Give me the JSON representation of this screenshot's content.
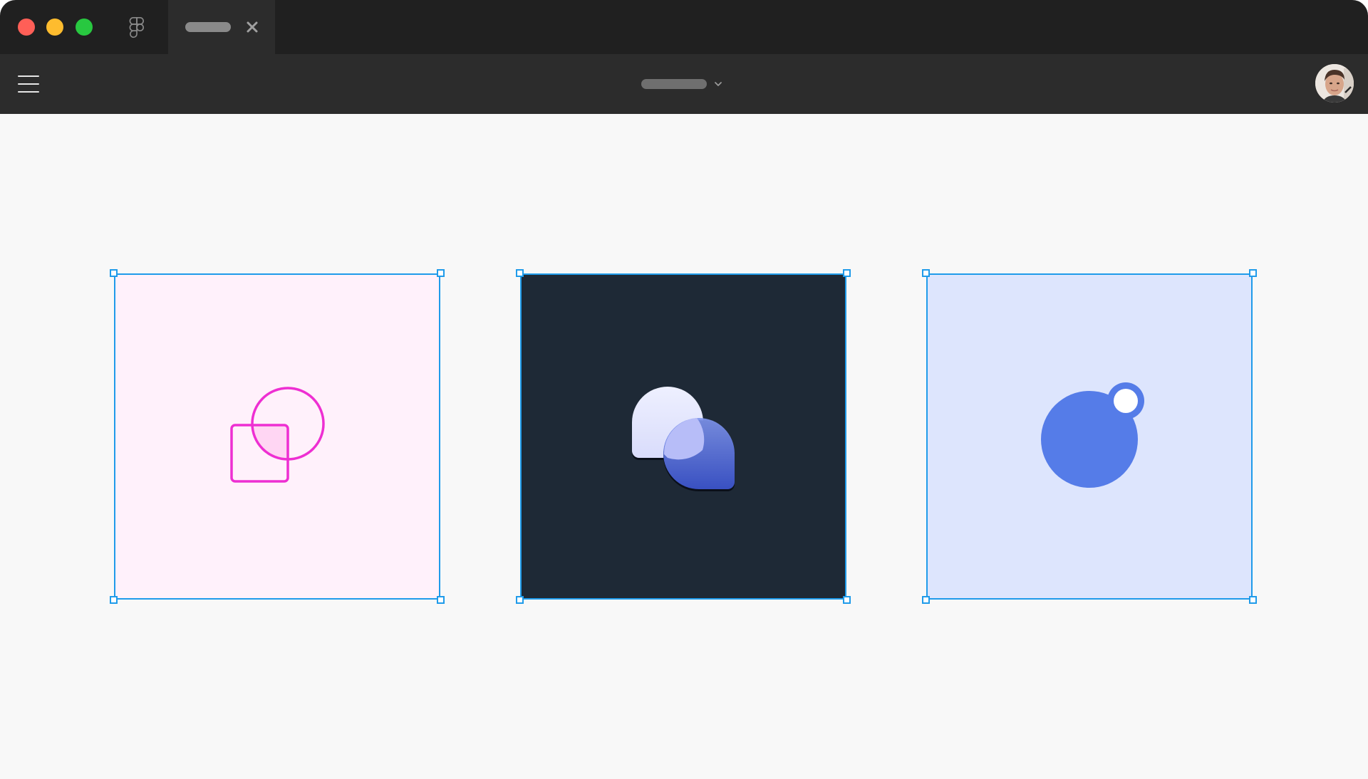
{
  "window": {
    "traffic_lights": [
      "close",
      "minimize",
      "maximize"
    ],
    "app_icon": "figma-logo-icon",
    "tab": {
      "close_icon": "close-icon"
    }
  },
  "toolbar": {
    "menu_icon": "hamburger-menu-icon",
    "file_menu_icon": "chevron-down-icon",
    "avatar": "user-avatar"
  },
  "canvas": {
    "frames": [
      {
        "name": "shapes-frame",
        "fill": "#fff1fb",
        "icon": "square-and-circle-icon",
        "accent": "#ee2fd2"
      },
      {
        "name": "bubbles-frame",
        "fill": "#1e2936",
        "icon": "overlapping-bubbles-icon",
        "accent": "#5b74e6"
      },
      {
        "name": "notification-frame",
        "fill": "#dde5fd",
        "icon": "notification-dot-icon",
        "accent": "#557ce8"
      }
    ],
    "selection_color": "#1f9bea"
  },
  "colors": {
    "titlebar": "#202020",
    "toolbar": "#2c2c2c",
    "canvas": "#f8f8f8",
    "close": "#ff5f57",
    "minimize": "#febc2e",
    "maximize": "#28c840"
  }
}
